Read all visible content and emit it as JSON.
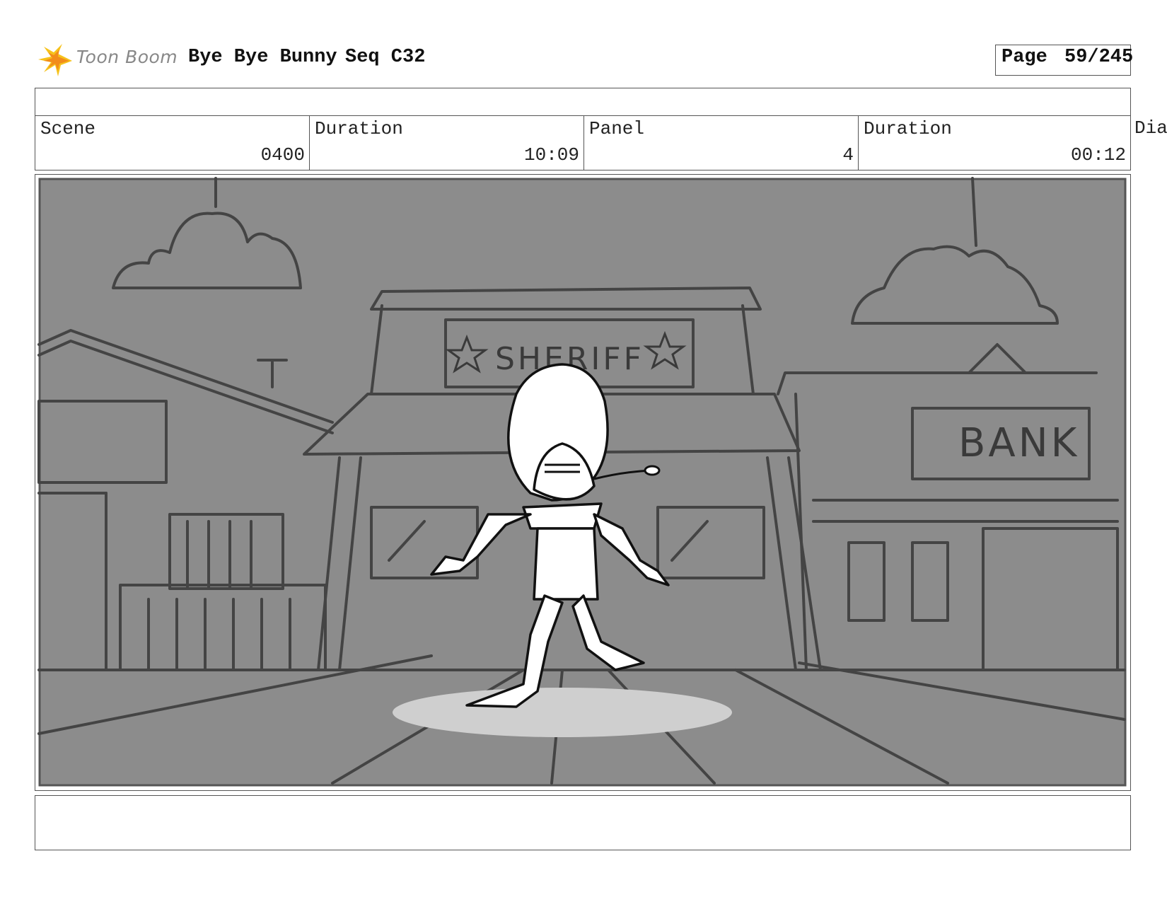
{
  "brand": {
    "logo_text": "Toon Boom",
    "logo_color": "#f5c518"
  },
  "header": {
    "project_title": "Bye Bye Bunny",
    "sequence": "Seq C32",
    "page_label": "Page",
    "page_number": "59/245"
  },
  "info": {
    "scene_label": "Scene",
    "scene_value": "0400",
    "scene_duration_label": "Duration",
    "scene_duration_value": "10:09",
    "panel_label": "Panel",
    "panel_value": "4",
    "panel_duration_label": "Duration",
    "panel_duration_value": "00:12",
    "dialogue_label": "Dia"
  },
  "panel_image": {
    "sheriff_sign": "SHERIFF",
    "bank_sign": "BANK",
    "background_color": "#8c8c8c"
  },
  "dialogue": {
    "text": ""
  }
}
